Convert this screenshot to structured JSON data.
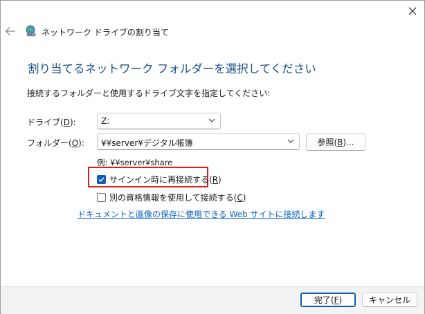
{
  "window": {
    "title": "ネットワーク ドライブの割り当て",
    "close_label": "×"
  },
  "main": {
    "heading": "割り当てるネットワーク フォルダーを選択してください",
    "instructions": "接続するフォルダーと使用するドライブ文字を指定してください:",
    "drive": {
      "label_prefix": "ドライブ(",
      "label_key": "D",
      "label_suffix": "):",
      "value": "Z:"
    },
    "folder": {
      "label_prefix": "フォルダー(",
      "label_key": "O",
      "label_suffix": "):",
      "value": "¥¥server¥デジタル帳簿"
    },
    "browse": {
      "label_prefix": "参照(",
      "label_key": "B",
      "label_suffix": ")..."
    },
    "example": "例: ¥¥server¥share",
    "reconnect": {
      "label_prefix": "サインイン時に再接続する(",
      "label_key": "R",
      "label_suffix": ")",
      "checked": true
    },
    "other_credentials": {
      "label_prefix": "別の資格情報を使用して接続する(",
      "label_key": "C",
      "label_suffix": ")",
      "checked": false
    },
    "link": "ドキュメントと画像の保存に使用できる Web サイトに接続します"
  },
  "footer": {
    "finish": {
      "label_prefix": "完了(",
      "label_key": "F",
      "label_suffix": ")"
    },
    "cancel_label": "キャンセル"
  },
  "colors": {
    "heading": "#1b4f86",
    "accent": "#0a5fb4",
    "link": "#0a63c6",
    "highlight_border": "#e21d1d"
  },
  "icons": {
    "close": "close-icon",
    "back": "back-arrow-icon",
    "title": "network-drive-icon",
    "dropdown": "chevron-down-icon",
    "checkbox": "checkmark-icon"
  }
}
